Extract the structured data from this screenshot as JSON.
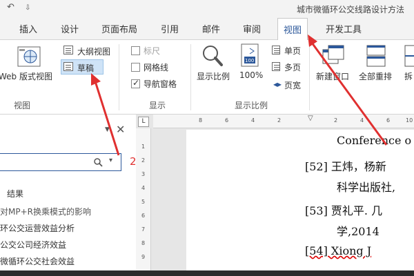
{
  "window": {
    "title": "城市微循环公交线路设计方法"
  },
  "quick_access": {
    "undo": "↶",
    "customize": "⇩"
  },
  "tabs": [
    "插入",
    "设计",
    "页面布局",
    "引用",
    "邮件",
    "审阅",
    "视图",
    "开发工具"
  ],
  "ribbon": {
    "views": {
      "web_layout": "Web 版式视图",
      "outline": "大纲视图",
      "draft": "草稿",
      "group": "视图"
    },
    "show": {
      "ruler": "标尺",
      "gridlines": "网格线",
      "nav_pane": "导航窗格",
      "group": "显示",
      "ruler_checked": false,
      "gridlines_checked": false,
      "nav_pane_checked": true
    },
    "zoom": {
      "zoom": "显示比例",
      "hundred": "100%",
      "one_page": "单页",
      "multi_page": "多页",
      "page_width": "页宽",
      "group": "显示比例"
    },
    "window": {
      "new_window": "新建窗口",
      "arrange_all": "全部重排",
      "split": "拆"
    }
  },
  "nav": {
    "close": "✕",
    "dropdown": "▼",
    "search_dropdown": "▾",
    "results_label": "结果",
    "items": [
      "对MP+R换乘模式的影响",
      "环公交运营效益分析",
      "公交公司经济效益",
      "微循环公交社会效益"
    ]
  },
  "annotation": {
    "number": "2"
  },
  "ruler": {
    "corner": "L",
    "top_ticks": [
      "8",
      "6",
      "4",
      "2",
      "2",
      "4",
      "6",
      "8",
      "10"
    ],
    "left_ticks": [
      "1",
      "2",
      "3",
      "4",
      "5",
      "6",
      "7",
      "8",
      "9",
      "10"
    ]
  },
  "document": {
    "lines": [
      {
        "text": "Conference o"
      },
      {
        "text": "[52] 王炜，杨新"
      },
      {
        "text": "科学出版社,"
      },
      {
        "text": "[53] 贾礼平. 几"
      },
      {
        "text": "学,2014"
      },
      {
        "text": "[54] Xiong J"
      }
    ]
  },
  "colors": {
    "accent": "#2b579a",
    "arrow": "#e03030"
  }
}
